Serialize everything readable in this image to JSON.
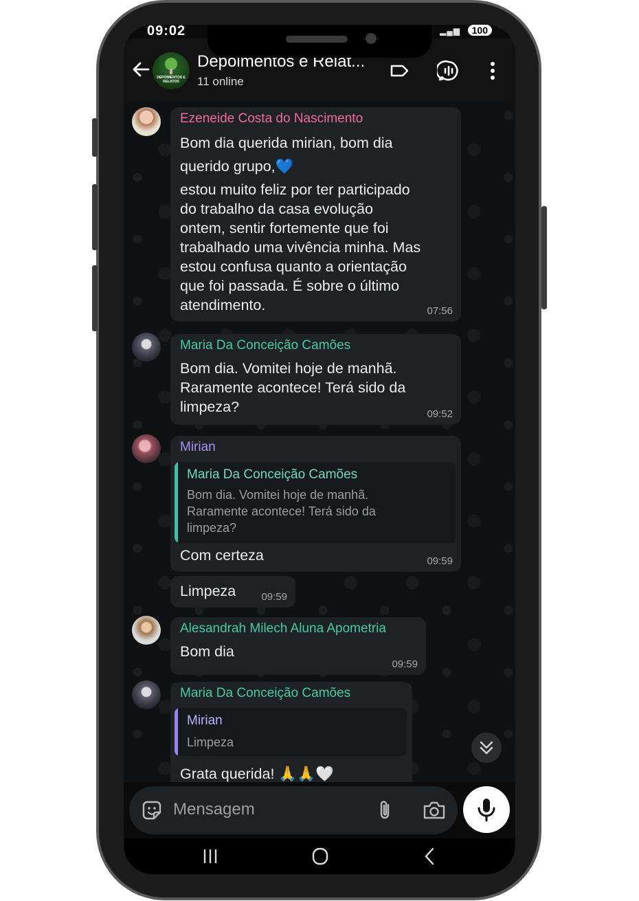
{
  "status_bar": {
    "time": "09:02",
    "battery": "100"
  },
  "header": {
    "title": "Depoimentos e Relat...",
    "subtitle": "11 online",
    "avatar_text": "DEPOIMENTOS E RELATOS"
  },
  "messages": [
    {
      "sender": "Ezeneide Costa do Nascimento",
      "sender_color": "#f06b95",
      "lines": [
        "Bom dia querida mirian, bom dia",
        "querido grupo,💙",
        "estou muito feliz por ter participado",
        "do trabalho da casa evolução",
        "ontem, sentir fortemente que foi",
        "trabalhado uma vivência minha. Mas",
        "estou confusa quanto a orientação",
        "que foi passada. É sobre o último",
        "atendimento."
      ],
      "time": "07:56"
    },
    {
      "sender": "Maria Da Conceição Camões",
      "sender_color": "#45c9a6",
      "lines": [
        "Bom dia. Vomitei hoje de manhã.",
        "Raramente acontece! Terá sido da",
        "limpeza?"
      ],
      "time": "09:52"
    },
    {
      "sender": "Mirian",
      "sender_color": "#a892f5",
      "quote": {
        "name": "Maria Da Conceição Camões",
        "name_color": "#72d9c0",
        "bar_color": "#3fc1a2",
        "lines": [
          "Bom dia. Vomitei hoje de manhã.",
          "Raramente acontece! Terá sido da",
          "limpeza?"
        ]
      },
      "text": "Com certeza",
      "time": "09:59"
    },
    {
      "text": "Limpeza",
      "time": "09:59"
    },
    {
      "sender": "Alesandrah Milech Aluna Apometria",
      "sender_color": "#45c9a6",
      "text": "Bom dia",
      "time": "09:59"
    },
    {
      "sender": "Maria Da Conceição Camões",
      "sender_color": "#45c9a6",
      "quote": {
        "name": "Mirian",
        "name_color": "#bfb0ff",
        "bar_color": "#9b84f0",
        "text": "Limpeza"
      },
      "text": "Grata querida! 🙏🙏🤍"
    }
  ],
  "composer": {
    "placeholder": "Mensagem"
  }
}
